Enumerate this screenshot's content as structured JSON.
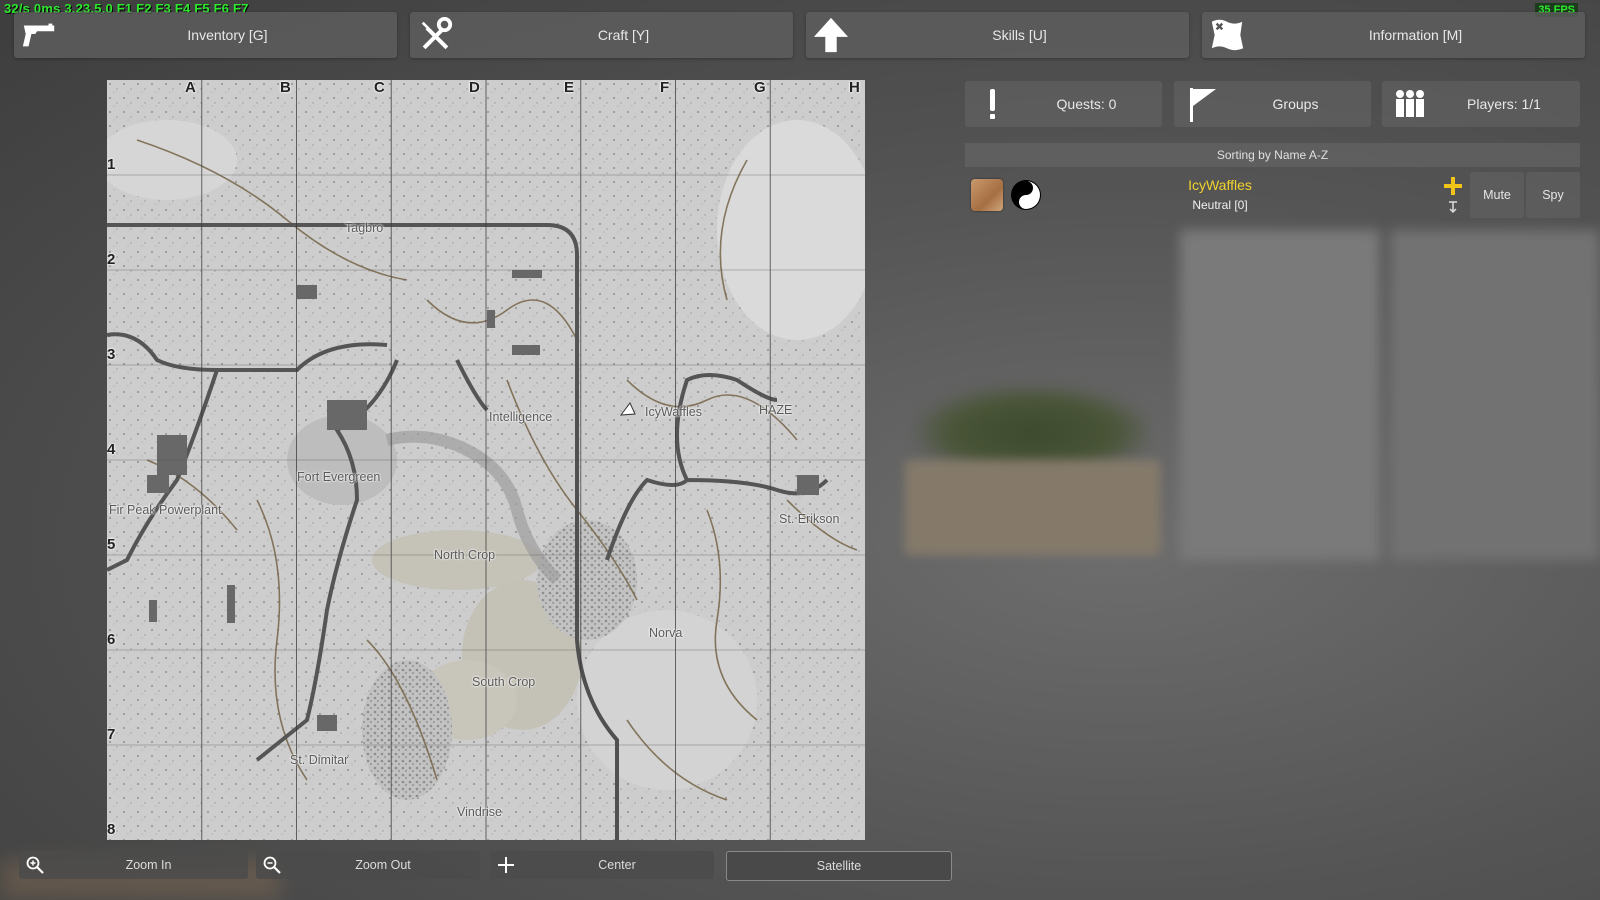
{
  "debug": {
    "left": "32/s 0ms 3.23.5.0 F1 F2 F3 F4 F5 F6 F7",
    "fps": "35 FPS"
  },
  "tabs": [
    {
      "label": "Inventory [G]",
      "icon": "pistol-icon"
    },
    {
      "label": "Craft [Y]",
      "icon": "tools-icon"
    },
    {
      "label": "Skills [U]",
      "icon": "arrow-up-icon"
    },
    {
      "label": "Information [M]",
      "icon": "map-scroll-icon"
    }
  ],
  "map": {
    "columns": [
      "A",
      "B",
      "C",
      "D",
      "E",
      "F",
      "G",
      "H"
    ],
    "rows": [
      "1",
      "2",
      "3",
      "4",
      "5",
      "6",
      "7",
      "8"
    ],
    "locations": {
      "tagbro": "Tagbro",
      "intelligence": "Intelligence",
      "player": "IcyWaffles",
      "haze": "HAZE",
      "fort_evergreen": "Fort Evergreen",
      "fir_peak": "Fir Peak Powerplant",
      "st_erikson": "St. Erikson",
      "north_crop": "North Crop",
      "norva": "Norva",
      "south_crop": "South Crop",
      "st_dimitar": "St. Dimitar",
      "vindrise": "Vindrise"
    }
  },
  "map_controls": {
    "zoom_in": "Zoom In",
    "zoom_out": "Zoom Out",
    "center": "Center",
    "satellite": "Satellite"
  },
  "right_panel": {
    "quests": "Quests: 0",
    "groups": "Groups",
    "players": "Players: 1/1",
    "sorting": "Sorting by Name A-Z",
    "player": {
      "name": "IcyWaffles",
      "status": "Neutral [0]",
      "mute": "Mute",
      "spy": "Spy"
    }
  },
  "colors": {
    "player_name": "#f2d22e",
    "add": "#f0c419",
    "debug": "#2ee82e"
  }
}
